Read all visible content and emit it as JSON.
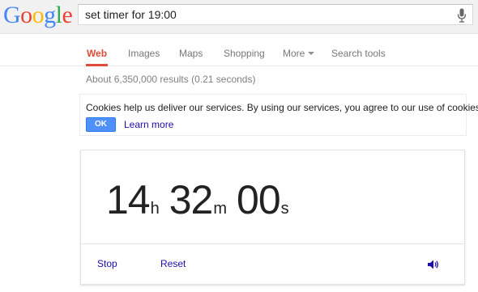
{
  "logo": {
    "letters": [
      "G",
      "o",
      "o",
      "g",
      "l",
      "e"
    ],
    "colors": [
      "#4285f4",
      "#ea4335",
      "#fbbc05",
      "#4285f4",
      "#34a853",
      "#ea4335"
    ]
  },
  "search": {
    "query": "set timer for 19:00",
    "mic_icon": "microphone-icon"
  },
  "tabs": [
    {
      "label": "Web",
      "active": true
    },
    {
      "label": "Images",
      "active": false
    },
    {
      "label": "Maps",
      "active": false
    },
    {
      "label": "Shopping",
      "active": false
    },
    {
      "label": "More",
      "active": false,
      "dropdown": true
    },
    {
      "label": "Search tools",
      "active": false
    }
  ],
  "result_stats": "About 6,350,000 results (0.21 seconds)",
  "cookie_notice": {
    "text": "Cookies help us deliver our services. By using our services, you agree to our use of cookies.",
    "ok_label": "OK",
    "learn_more_label": "Learn more"
  },
  "timer": {
    "hours": "14",
    "hours_unit": "h",
    "minutes": "32",
    "minutes_unit": "m",
    "seconds": "00",
    "seconds_unit": "s",
    "stop_label": "Stop",
    "reset_label": "Reset",
    "sound_icon": "speaker-icon"
  },
  "colors": {
    "accent_red": "#dd4b39",
    "link_blue": "#1a0dab",
    "button_blue": "#4d90fe",
    "header_bg": "#f1f1f1"
  }
}
